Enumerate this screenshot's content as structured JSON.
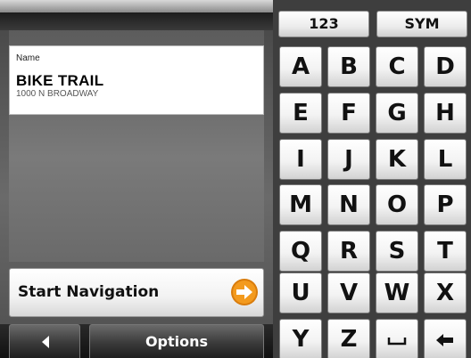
{
  "poi": {
    "label": "Name",
    "name": "BIKE TRAIL",
    "address": "1000 N BROADWAY"
  },
  "actions": {
    "start_navigation": "Start Navigation",
    "options": "Options",
    "back_icon": "chevron-left-icon",
    "start_icon": "orange-arrow-right-icon"
  },
  "keyboard": {
    "mode_keys": [
      "123",
      "SYM"
    ],
    "rows": [
      [
        "A",
        "B",
        "C",
        "D"
      ],
      [
        "E",
        "F",
        "G",
        "H"
      ],
      [
        "I",
        "J",
        "K",
        "L"
      ],
      [
        "M",
        "N",
        "O",
        "P"
      ],
      [
        "Q",
        "R",
        "S",
        "T"
      ],
      [
        "U",
        "V",
        "W",
        "X"
      ],
      [
        "Y",
        "Z"
      ]
    ],
    "space_icon": "space-icon",
    "backspace_icon": "backspace-icon"
  },
  "colors": {
    "accent_orange": "#f39a1e",
    "key_face": "#ffffff",
    "background": "#5a5a5a"
  }
}
